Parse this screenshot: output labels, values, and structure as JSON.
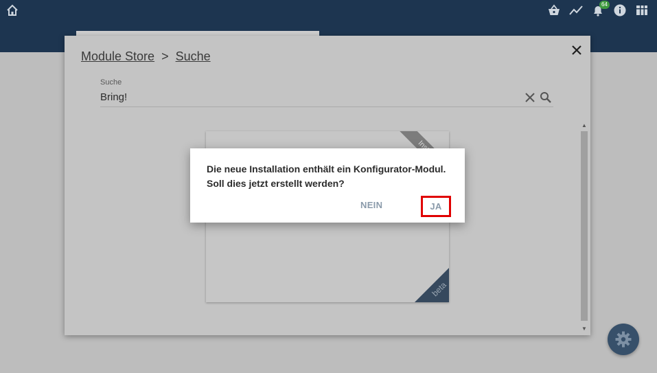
{
  "topbar": {
    "icons": [
      "home-icon",
      "basket-icon",
      "trend-icon",
      "bell-icon",
      "info-icon",
      "apps-icon"
    ],
    "notification_count": "64",
    "background": "#1d3550"
  },
  "store": {
    "breadcrumb": [
      "Module Store",
      "Suche"
    ],
    "breadcrumb_separator": ">",
    "search": {
      "label": "Suche",
      "value": "Bring!"
    },
    "card": {
      "ribbon_label": "Instal",
      "corner_label": "beta"
    }
  },
  "confirm": {
    "line1": "Die neue Installation enthält ein Konfigurator-Modul.",
    "line2": "Soll dies jetzt erstellt werden?",
    "no_label": "NEIN",
    "yes_label": "JA",
    "highlight_color": "#e00000"
  }
}
